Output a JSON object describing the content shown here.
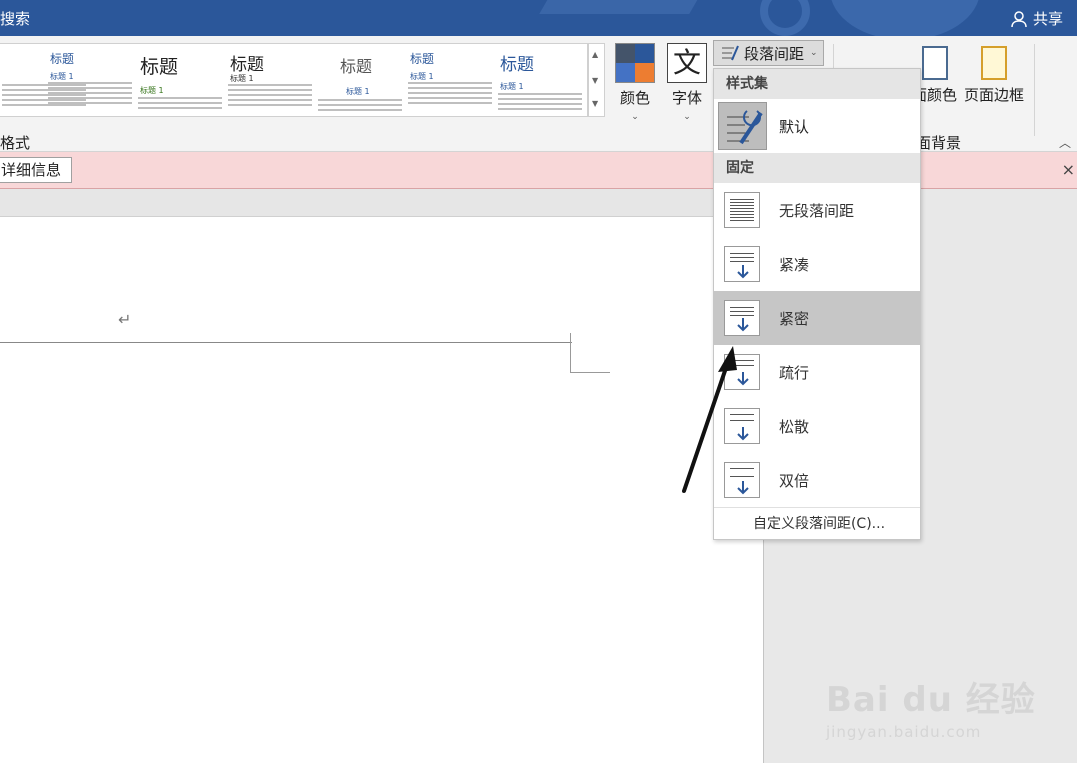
{
  "titlebar": {
    "search_label": "搜索",
    "share_label": "共享"
  },
  "ribbon": {
    "style_gallery": [
      {
        "title": "标题",
        "sub": "标题 1"
      },
      {
        "title": "标题",
        "sub": "标题 1"
      },
      {
        "title": "标题",
        "sub": "标题 1"
      },
      {
        "title": "标题",
        "sub": "标题 1"
      },
      {
        "title": "标题",
        "sub": "标题 1"
      },
      {
        "title": "标题",
        "sub": "标题 1"
      }
    ],
    "colors_label": "颜色",
    "fonts_label": "字体",
    "paragraph_spacing_label": "段落间距",
    "page_color_label": "面颜色",
    "page_border_label": "页面边框",
    "page_background_group": "面背景",
    "document_formatting_group": "格式",
    "theme_colors": [
      "#44546a",
      "#2b579a",
      "#4472c4",
      "#ed7d31"
    ]
  },
  "message_bar": {
    "details_button": "详细信息",
    "close_glyph": "×"
  },
  "document": {
    "paragraph_mark": "↵"
  },
  "spacing_menu": {
    "style_set_header": "样式集",
    "default_label": "默认",
    "fixed_header": "固定",
    "items": [
      {
        "label": "无段落间距"
      },
      {
        "label": "紧凑"
      },
      {
        "label": "紧密"
      },
      {
        "label": "疏行"
      },
      {
        "label": "松散"
      },
      {
        "label": "双倍"
      }
    ],
    "selected_item": "紧密",
    "custom_label": "自定义段落间距(C)..."
  },
  "watermark": {
    "brand": "Bai du 经验",
    "url": "jingyan.baidu.com"
  }
}
